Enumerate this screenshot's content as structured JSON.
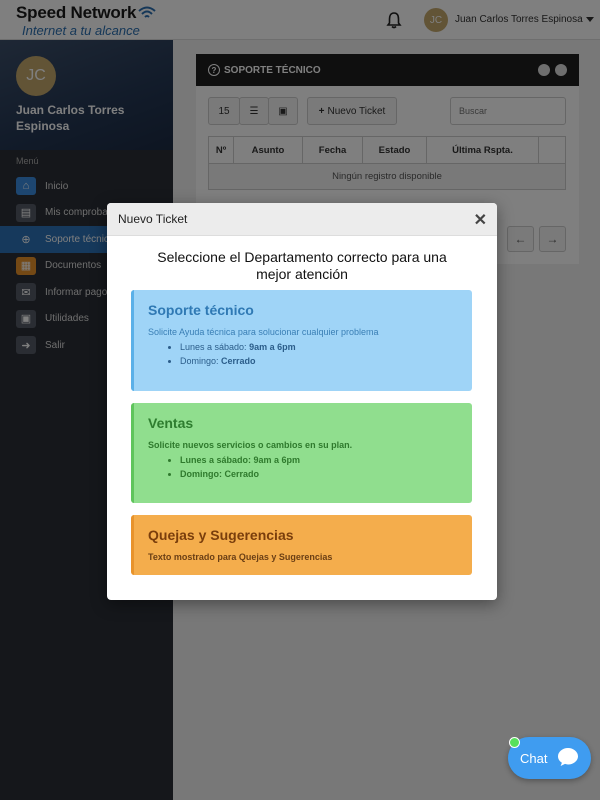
{
  "brand": {
    "name": "Speed Network",
    "tagline": "Internet a tu alcance"
  },
  "user": {
    "initials": "JC",
    "full_name": "Juan Carlos Torres Espinosa"
  },
  "sidebar": {
    "menu_title": "Menú",
    "items": [
      {
        "label": "Inicio",
        "icon": "home-icon",
        "color": "#3b8de0"
      },
      {
        "label": "Mis comprobantes",
        "icon": "receipt-icon",
        "color": "#555b66"
      },
      {
        "label": "Soporte técnico",
        "icon": "lifebuoy-icon",
        "color": "#2c72b8"
      },
      {
        "label": "Documentos",
        "icon": "document-icon",
        "color": "#e8932b"
      },
      {
        "label": "Informar pago",
        "icon": "mail-icon",
        "color": "#555b66"
      },
      {
        "label": "Utilidades",
        "icon": "briefcase-icon",
        "color": "#555b66"
      },
      {
        "label": "Salir",
        "icon": "logout-icon",
        "color": "#555b66"
      }
    ]
  },
  "card": {
    "title": "SOPORTE TÉCNICO",
    "page_size": "15",
    "new_ticket_label": "Nuevo Ticket",
    "search_placeholder": "Buscar",
    "columns": [
      "Nº",
      "Asunto",
      "Fecha",
      "Estado",
      "Última Rspta."
    ],
    "empty_message": "Ningún registro disponible"
  },
  "modal": {
    "header": "Nuevo Ticket",
    "title": "Seleccione el Departamento correcto para una mejor atención",
    "departments": [
      {
        "name": "Soporte técnico",
        "description": "Solicite Ayuda técnica para solucionar cualquier problema",
        "schedule": [
          {
            "label": "Lunes a sábado:",
            "value": "9am a 6pm"
          },
          {
            "label": "Domingo:",
            "value": "Cerrado"
          }
        ],
        "color": "#9fd4f7"
      },
      {
        "name": "Ventas",
        "description": "Solicite nuevos servicios o cambios en su plan.",
        "schedule": [
          {
            "label": "Lunes a sábado:",
            "value": "9am a 6pm"
          },
          {
            "label": "Domingo:",
            "value": "Cerrado"
          }
        ],
        "color": "#90de8e"
      },
      {
        "name": "Quejas y Sugerencias",
        "description": "Texto mostrado para Quejas y Sugerencias",
        "color": "#f4ad4c"
      }
    ]
  },
  "chat": {
    "label": "Chat",
    "status_color": "#57e05a"
  }
}
